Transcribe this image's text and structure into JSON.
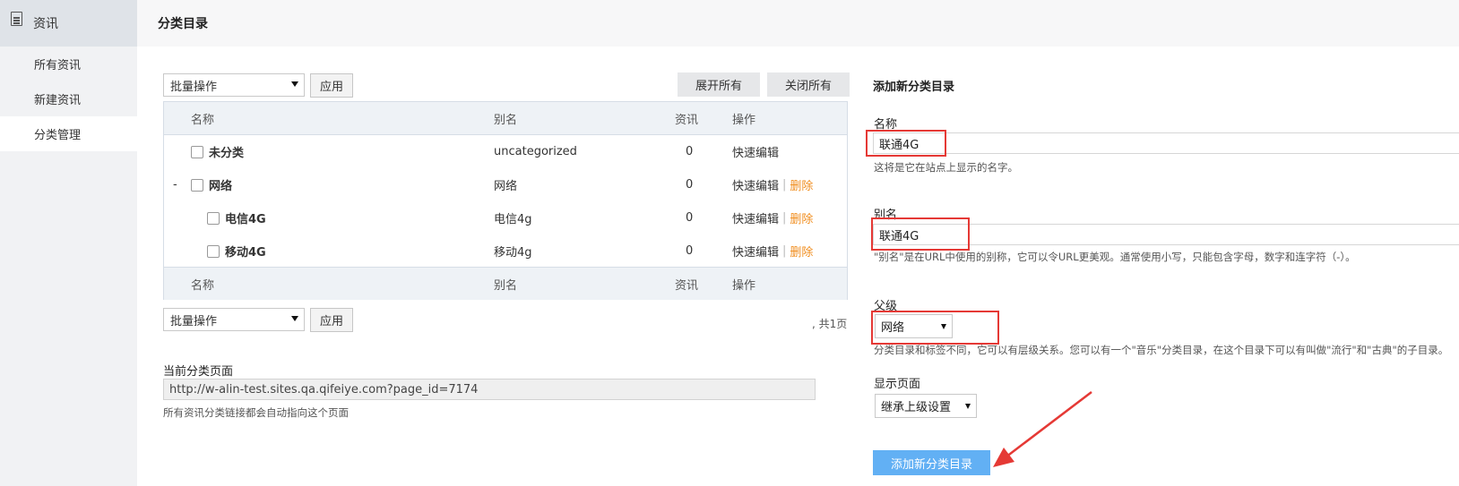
{
  "sidebar": {
    "section_title": "资讯",
    "items": [
      {
        "label": "所有资讯"
      },
      {
        "label": "新建资讯"
      },
      {
        "label": "分类管理"
      }
    ]
  },
  "header": {
    "title": "分类目录"
  },
  "bulk_top": {
    "select_value": "批量操作",
    "apply": "应用"
  },
  "bulk_bottom": {
    "select_value": "批量操作",
    "apply": "应用"
  },
  "expand_all": "展开所有",
  "collapse_all": "关闭所有",
  "table": {
    "columns": {
      "name": "名称",
      "slug": "别名",
      "count": "资讯",
      "actions": "操作"
    },
    "rows": [
      {
        "toggle": "",
        "name": "未分类",
        "slug": "uncategorized",
        "count": "0",
        "edit": "快速编辑",
        "delete": ""
      },
      {
        "toggle": "-",
        "name": "网络",
        "slug": "网络",
        "count": "0",
        "edit": "快速编辑",
        "delete": "删除"
      },
      {
        "toggle": "",
        "name": "电信4G",
        "slug": "电信4g",
        "count": "0",
        "edit": "快速编辑",
        "delete": "删除"
      },
      {
        "toggle": "",
        "name": "移动4G",
        "slug": "移动4g",
        "count": "0",
        "edit": "快速编辑",
        "delete": "删除"
      }
    ]
  },
  "pagination": ", 共1页",
  "current_page": {
    "label": "当前分类页面",
    "url": "http://w-alin-test.sites.qa.qifeiye.com?page_id=7174",
    "note": "所有资讯分类链接都会自动指向这个页面"
  },
  "form": {
    "title": "添加新分类目录",
    "name_label": "名称",
    "name_value": "联通4G",
    "name_hint": "这将是它在站点上显示的名字。",
    "slug_label": "别名",
    "slug_value": "联通4G",
    "slug_hint": "\"别名\"是在URL中使用的别称，它可以令URL更美观。通常使用小写，只能包含字母，数字和连字符（-）。",
    "parent_label": "父级",
    "parent_value": "网络",
    "parent_hint": "分类目录和标签不同，它可以有层级关系。您可以有一个\"音乐\"分类目录，在这个目录下可以有叫做\"流行\"和\"古典\"的子目录。",
    "display_label": "显示页面",
    "display_value": "继承上级设置",
    "submit": "添加新分类目录"
  },
  "colors": {
    "highlight": "#e53935",
    "submit": "#62b0f4",
    "delete_link": "#f08d1e"
  }
}
